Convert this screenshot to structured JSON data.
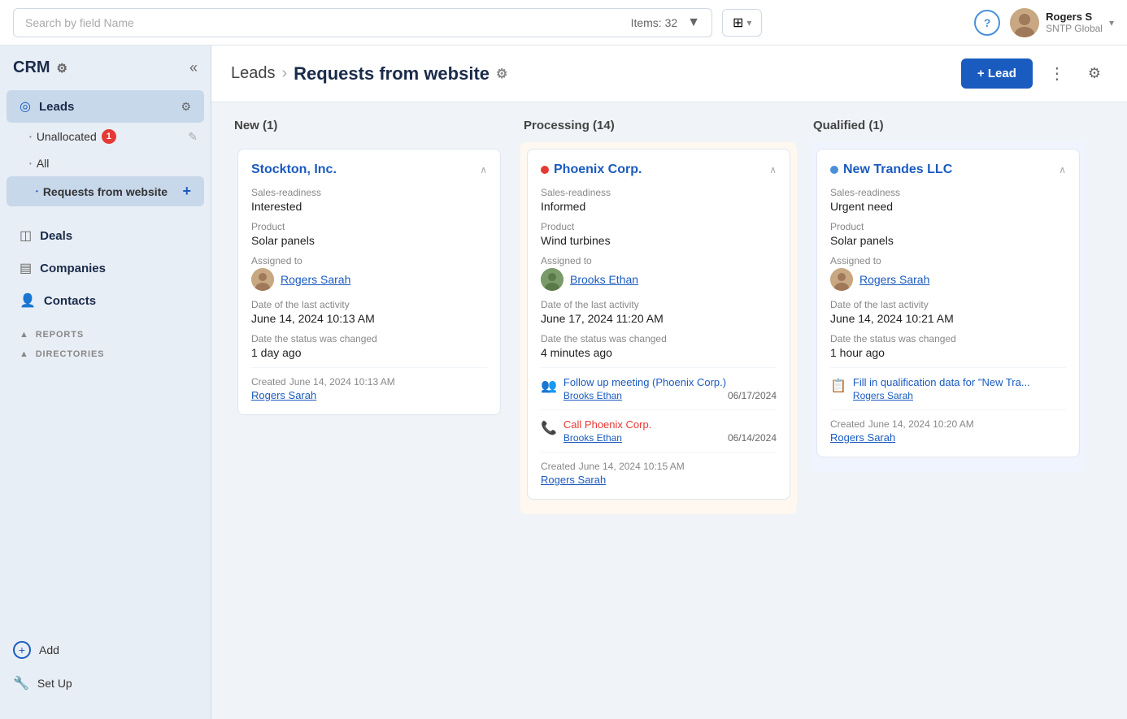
{
  "topbar": {
    "search_placeholder": "Search by field Name",
    "items_count": "Items: 32",
    "filter_icon": "filter",
    "view_icon": "grid",
    "help_icon": "?",
    "user": {
      "name": "Rogers S",
      "company": "SNTP Global"
    }
  },
  "sidebar": {
    "logo": "CRM",
    "nav": [
      {
        "id": "leads",
        "label": "Leads",
        "active": true
      },
      {
        "id": "deals",
        "label": "Deals"
      },
      {
        "id": "companies",
        "label": "Companies"
      },
      {
        "id": "contacts",
        "label": "Contacts"
      }
    ],
    "leads_sub": [
      {
        "id": "unallocated",
        "label": "Unallocated",
        "badge": "1"
      },
      {
        "id": "all",
        "label": "All"
      },
      {
        "id": "requests",
        "label": "Requests from website",
        "active": true
      }
    ],
    "sections": [
      {
        "id": "reports",
        "label": "REPORTS"
      },
      {
        "id": "directories",
        "label": "DIRECTORIES"
      }
    ],
    "bottom": [
      {
        "id": "add",
        "label": "Add"
      },
      {
        "id": "setup",
        "label": "Set Up"
      }
    ]
  },
  "header": {
    "breadcrumb_root": "Leads",
    "breadcrumb_current": "Requests from website",
    "add_lead_label": "+ Lead"
  },
  "columns": [
    {
      "id": "new",
      "title": "New (1)",
      "cards": [
        {
          "id": "stockton",
          "title": "Stockton, Inc.",
          "dot_color": "none",
          "sales_readiness_label": "Sales-readiness",
          "sales_readiness": "Interested",
          "product_label": "Product",
          "product": "Solar panels",
          "assigned_to_label": "Assigned to",
          "assigned_name": "Rogers Sarah",
          "date_last_activity_label": "Date of the last activity",
          "date_last_activity": "June 14, 2024 10:13 AM",
          "date_status_changed_label": "Date the status was changed",
          "date_status_changed": "1 day ago",
          "created_label": "Created",
          "created_date": "June 14, 2024 10:13 AM",
          "created_by": "Rogers Sarah",
          "activities": []
        }
      ]
    },
    {
      "id": "processing",
      "title": "Processing (14)",
      "cards": [
        {
          "id": "phoenix",
          "title": "Phoenix Corp.",
          "dot_color": "red",
          "sales_readiness_label": "Sales-readiness",
          "sales_readiness": "Informed",
          "product_label": "Product",
          "product": "Wind turbines",
          "assigned_to_label": "Assigned to",
          "assigned_name": "Brooks Ethan",
          "date_last_activity_label": "Date of the last activity",
          "date_last_activity": "June 17, 2024 11:20 AM",
          "date_status_changed_label": "Date the status was changed",
          "date_status_changed": "4 minutes ago",
          "created_label": "Created",
          "created_date": "June 14, 2024 10:15 AM",
          "created_by": "Rogers Sarah",
          "activities": [
            {
              "id": "followup",
              "icon": "group",
              "icon_type": "normal",
              "title": "Follow up meeting (Phoenix Corp.)",
              "person": "Brooks Ethan",
              "date": "06/17/2024"
            },
            {
              "id": "call",
              "icon": "phone",
              "icon_type": "red",
              "title": "Call Phoenix Corp.",
              "person": "Brooks Ethan",
              "date": "06/14/2024"
            }
          ]
        }
      ]
    },
    {
      "id": "qualified",
      "title": "Qualified (1)",
      "cards": [
        {
          "id": "newtrandes",
          "title": "New Trandes LLC",
          "dot_color": "blue",
          "sales_readiness_label": "Sales-readiness",
          "sales_readiness": "Urgent need",
          "product_label": "Product",
          "product": "Solar panels",
          "assigned_to_label": "Assigned to",
          "assigned_name": "Rogers Sarah",
          "date_last_activity_label": "Date of the last activity",
          "date_last_activity": "June 14, 2024 10:21 AM",
          "date_status_changed_label": "Date the status was changed",
          "date_status_changed": "1 hour ago",
          "created_label": "Created",
          "created_date": "June 14, 2024 10:20 AM",
          "created_by": "Rogers Sarah",
          "activities": [
            {
              "id": "fillqualification",
              "icon": "clipboard",
              "icon_type": "normal",
              "title": "Fill in qualification data for \"New Tra...",
              "person": "Rogers Sarah",
              "date": ""
            }
          ]
        }
      ]
    }
  ]
}
